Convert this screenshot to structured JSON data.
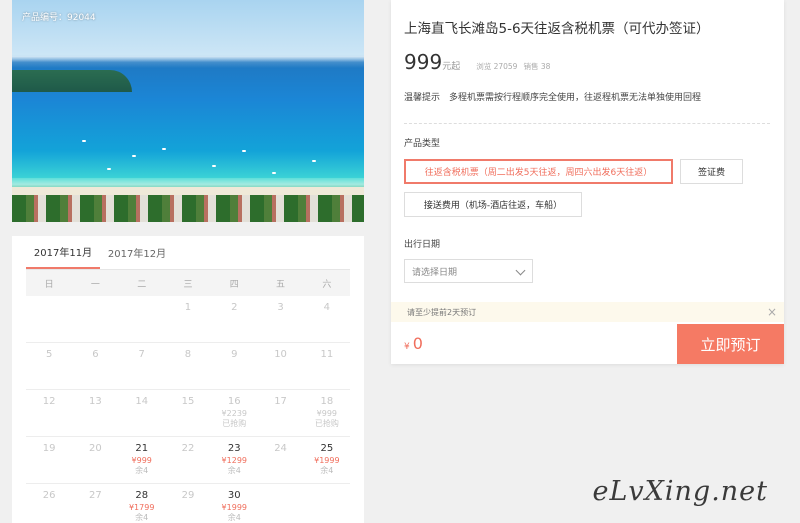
{
  "photo": {
    "product_id_label": "产品编号：92044"
  },
  "product": {
    "title": "上海直飞长滩岛5-6天往返含税机票（可代办签证）",
    "price": "999",
    "price_unit": "元起",
    "views": "浏览 27059",
    "sales": "销售 38",
    "tip": "温馨提示　多程机票需按行程顺序完全使用，往返程机票无法单独使用回程"
  },
  "options": {
    "type_label": "产品类型",
    "items": [
      "往返含税机票（周二出发5天往返，周四六出发6天往返）",
      "签证费",
      "接送费用（机场-酒店往返，车船）"
    ]
  },
  "date": {
    "label": "出行日期",
    "placeholder": "请选择日期"
  },
  "notice": {
    "text": "请至少提前2天预订",
    "close": "×"
  },
  "order": {
    "currency": "¥",
    "total": "0",
    "book_label": "立即预订"
  },
  "calendar": {
    "tabs": [
      "2017年11月",
      "2017年12月"
    ],
    "weekdays": [
      "日",
      "一",
      "二",
      "三",
      "四",
      "五",
      "六"
    ],
    "weeks": [
      [
        {
          "d": ""
        },
        {
          "d": ""
        },
        {
          "d": ""
        },
        {
          "d": "1"
        },
        {
          "d": "2"
        },
        {
          "d": "3"
        },
        {
          "d": "4"
        }
      ],
      [
        {
          "d": "5"
        },
        {
          "d": "6"
        },
        {
          "d": "7"
        },
        {
          "d": "8"
        },
        {
          "d": "9"
        },
        {
          "d": "10"
        },
        {
          "d": "11"
        }
      ],
      [
        {
          "d": "12"
        },
        {
          "d": "13"
        },
        {
          "d": "14"
        },
        {
          "d": "15"
        },
        {
          "d": "16",
          "p": "¥2239",
          "s": "已抢购",
          "past": true
        },
        {
          "d": "17"
        },
        {
          "d": "18",
          "p": "¥999",
          "s": "已抢购",
          "past": true
        }
      ],
      [
        {
          "d": "19"
        },
        {
          "d": "20"
        },
        {
          "d": "21",
          "p": "¥999",
          "s": "余4",
          "avail": true
        },
        {
          "d": "22"
        },
        {
          "d": "23",
          "p": "¥1299",
          "s": "余4",
          "avail": true
        },
        {
          "d": "24"
        },
        {
          "d": "25",
          "p": "¥1999",
          "s": "余4",
          "avail": true
        }
      ],
      [
        {
          "d": "26"
        },
        {
          "d": "27"
        },
        {
          "d": "28",
          "p": "¥1799",
          "s": "余4",
          "avail": true
        },
        {
          "d": "29"
        },
        {
          "d": "30",
          "p": "¥1999",
          "s": "余4",
          "avail": true
        },
        {
          "d": ""
        },
        {
          "d": ""
        }
      ]
    ]
  },
  "watermark": "eLvXing.net"
}
